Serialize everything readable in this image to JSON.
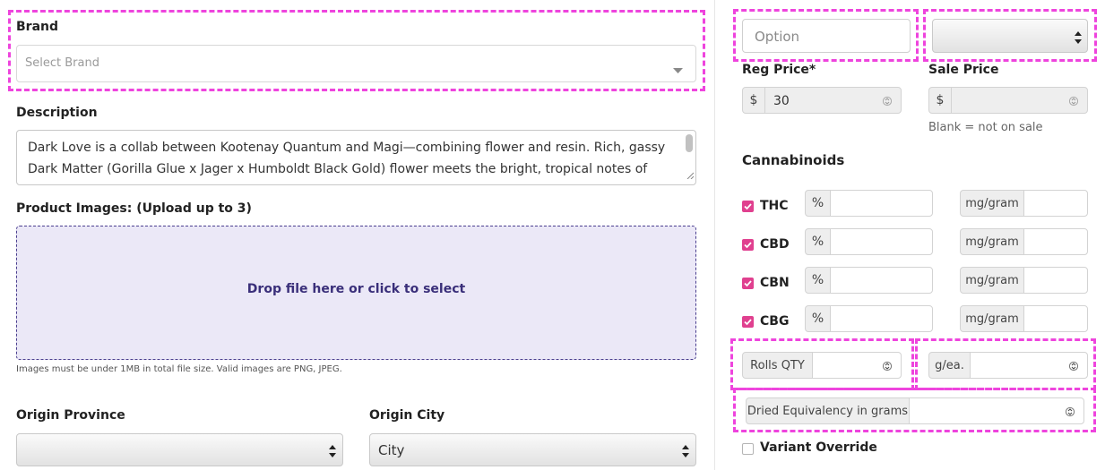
{
  "brand": {
    "label": "Brand",
    "placeholder": "Select Brand"
  },
  "description": {
    "label": "Description",
    "line1": "Dark Love is a collab between Kootenay Quantum and Magi—combining flower and resin. Rich, gassy",
    "line2": "Dark Matter (Gorilla Glue x Jager x Humboldt Black Gold) flower meets the bright, tropical notes of"
  },
  "images": {
    "label": "Product Images: (Upload up to 3)",
    "drop_text": "Drop file here or click to select",
    "help": "Images must be under 1MB in total file size. Valid images are PNG, JPEG."
  },
  "origin": {
    "province_label": "Origin Province",
    "province_value": "",
    "city_label": "Origin City",
    "city_value": "City"
  },
  "option": {
    "placeholder": "Option",
    "select_value": ""
  },
  "prices": {
    "reg_label": "Reg Price*",
    "reg_prefix": "$",
    "reg_value": "30",
    "sale_label": "Sale Price",
    "sale_prefix": "$",
    "sale_value": "",
    "sale_help": "Blank = not on sale"
  },
  "cannabinoids": {
    "title": "Cannabinoids",
    "percent_symbol": "%",
    "unit_label": "mg/gram",
    "items": [
      {
        "name": "THC",
        "checked": true
      },
      {
        "name": "CBD",
        "checked": true
      },
      {
        "name": "CBN",
        "checked": true
      },
      {
        "name": "CBG",
        "checked": true
      }
    ]
  },
  "rolls": {
    "qty_label": "Rolls QTY",
    "g_ea_label": "g/ea."
  },
  "dried": {
    "label": "Dried Equivalency in grams"
  },
  "variant": {
    "label": "Variant Override",
    "checked": false
  },
  "colors": {
    "highlight": "#ee44dd",
    "check": "#e0408f",
    "drop_bg": "#ebe8f7",
    "drop_border": "#4b3f8f",
    "drop_text": "#3a2f7a"
  }
}
